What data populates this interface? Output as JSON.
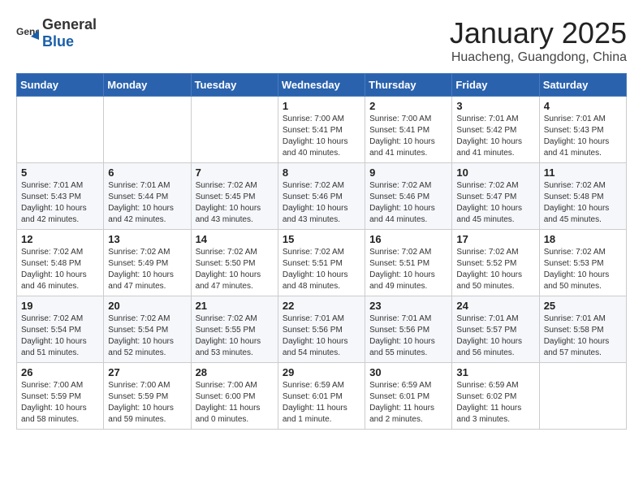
{
  "header": {
    "logo_general": "General",
    "logo_blue": "Blue",
    "month": "January 2025",
    "location": "Huacheng, Guangdong, China"
  },
  "weekdays": [
    "Sunday",
    "Monday",
    "Tuesday",
    "Wednesday",
    "Thursday",
    "Friday",
    "Saturday"
  ],
  "weeks": [
    [
      {
        "day": "",
        "info": ""
      },
      {
        "day": "",
        "info": ""
      },
      {
        "day": "",
        "info": ""
      },
      {
        "day": "1",
        "info": "Sunrise: 7:00 AM\nSunset: 5:41 PM\nDaylight: 10 hours\nand 40 minutes."
      },
      {
        "day": "2",
        "info": "Sunrise: 7:00 AM\nSunset: 5:41 PM\nDaylight: 10 hours\nand 41 minutes."
      },
      {
        "day": "3",
        "info": "Sunrise: 7:01 AM\nSunset: 5:42 PM\nDaylight: 10 hours\nand 41 minutes."
      },
      {
        "day": "4",
        "info": "Sunrise: 7:01 AM\nSunset: 5:43 PM\nDaylight: 10 hours\nand 41 minutes."
      }
    ],
    [
      {
        "day": "5",
        "info": "Sunrise: 7:01 AM\nSunset: 5:43 PM\nDaylight: 10 hours\nand 42 minutes."
      },
      {
        "day": "6",
        "info": "Sunrise: 7:01 AM\nSunset: 5:44 PM\nDaylight: 10 hours\nand 42 minutes."
      },
      {
        "day": "7",
        "info": "Sunrise: 7:02 AM\nSunset: 5:45 PM\nDaylight: 10 hours\nand 43 minutes."
      },
      {
        "day": "8",
        "info": "Sunrise: 7:02 AM\nSunset: 5:46 PM\nDaylight: 10 hours\nand 43 minutes."
      },
      {
        "day": "9",
        "info": "Sunrise: 7:02 AM\nSunset: 5:46 PM\nDaylight: 10 hours\nand 44 minutes."
      },
      {
        "day": "10",
        "info": "Sunrise: 7:02 AM\nSunset: 5:47 PM\nDaylight: 10 hours\nand 45 minutes."
      },
      {
        "day": "11",
        "info": "Sunrise: 7:02 AM\nSunset: 5:48 PM\nDaylight: 10 hours\nand 45 minutes."
      }
    ],
    [
      {
        "day": "12",
        "info": "Sunrise: 7:02 AM\nSunset: 5:48 PM\nDaylight: 10 hours\nand 46 minutes."
      },
      {
        "day": "13",
        "info": "Sunrise: 7:02 AM\nSunset: 5:49 PM\nDaylight: 10 hours\nand 47 minutes."
      },
      {
        "day": "14",
        "info": "Sunrise: 7:02 AM\nSunset: 5:50 PM\nDaylight: 10 hours\nand 47 minutes."
      },
      {
        "day": "15",
        "info": "Sunrise: 7:02 AM\nSunset: 5:51 PM\nDaylight: 10 hours\nand 48 minutes."
      },
      {
        "day": "16",
        "info": "Sunrise: 7:02 AM\nSunset: 5:51 PM\nDaylight: 10 hours\nand 49 minutes."
      },
      {
        "day": "17",
        "info": "Sunrise: 7:02 AM\nSunset: 5:52 PM\nDaylight: 10 hours\nand 50 minutes."
      },
      {
        "day": "18",
        "info": "Sunrise: 7:02 AM\nSunset: 5:53 PM\nDaylight: 10 hours\nand 50 minutes."
      }
    ],
    [
      {
        "day": "19",
        "info": "Sunrise: 7:02 AM\nSunset: 5:54 PM\nDaylight: 10 hours\nand 51 minutes."
      },
      {
        "day": "20",
        "info": "Sunrise: 7:02 AM\nSunset: 5:54 PM\nDaylight: 10 hours\nand 52 minutes."
      },
      {
        "day": "21",
        "info": "Sunrise: 7:02 AM\nSunset: 5:55 PM\nDaylight: 10 hours\nand 53 minutes."
      },
      {
        "day": "22",
        "info": "Sunrise: 7:01 AM\nSunset: 5:56 PM\nDaylight: 10 hours\nand 54 minutes."
      },
      {
        "day": "23",
        "info": "Sunrise: 7:01 AM\nSunset: 5:56 PM\nDaylight: 10 hours\nand 55 minutes."
      },
      {
        "day": "24",
        "info": "Sunrise: 7:01 AM\nSunset: 5:57 PM\nDaylight: 10 hours\nand 56 minutes."
      },
      {
        "day": "25",
        "info": "Sunrise: 7:01 AM\nSunset: 5:58 PM\nDaylight: 10 hours\nand 57 minutes."
      }
    ],
    [
      {
        "day": "26",
        "info": "Sunrise: 7:00 AM\nSunset: 5:59 PM\nDaylight: 10 hours\nand 58 minutes."
      },
      {
        "day": "27",
        "info": "Sunrise: 7:00 AM\nSunset: 5:59 PM\nDaylight: 10 hours\nand 59 minutes."
      },
      {
        "day": "28",
        "info": "Sunrise: 7:00 AM\nSunset: 6:00 PM\nDaylight: 11 hours\nand 0 minutes."
      },
      {
        "day": "29",
        "info": "Sunrise: 6:59 AM\nSunset: 6:01 PM\nDaylight: 11 hours\nand 1 minute."
      },
      {
        "day": "30",
        "info": "Sunrise: 6:59 AM\nSunset: 6:01 PM\nDaylight: 11 hours\nand 2 minutes."
      },
      {
        "day": "31",
        "info": "Sunrise: 6:59 AM\nSunset: 6:02 PM\nDaylight: 11 hours\nand 3 minutes."
      },
      {
        "day": "",
        "info": ""
      }
    ]
  ]
}
